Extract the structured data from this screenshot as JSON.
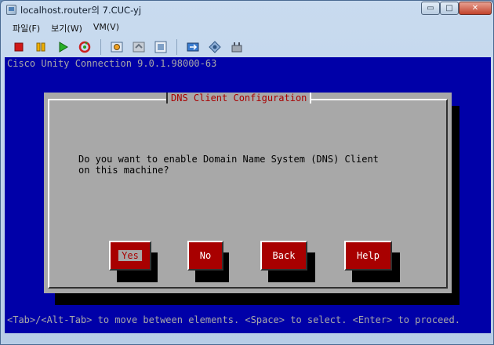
{
  "window": {
    "title": "localhost.router의 7.CUC-yj",
    "minimize_glyph": "▭",
    "maximize_glyph": "□",
    "close_glyph": "✕"
  },
  "menu": {
    "items": [
      "파일(F)",
      "보기(W)",
      "VM(V)"
    ]
  },
  "toolbar": {
    "icons": [
      "stop-icon",
      "pause-icon",
      "play-icon",
      "reset-icon",
      "snapshot-icon",
      "revert-snapshot-icon",
      "manage-snapshots-icon",
      "fullscreen-icon",
      "unity-icon",
      "console-settings-icon"
    ]
  },
  "console": {
    "header": "Cisco Unity Connection 9.0.1.98000-63",
    "dialog": {
      "title": "DNS Client Configuration",
      "message_line1": "Do you want to enable Domain Name System (DNS) Client",
      "message_line2": "on this machine?",
      "buttons": {
        "yes": "Yes",
        "no": "No",
        "back": "Back",
        "help": "Help"
      }
    },
    "footer": "<Tab>/<Alt-Tab> to move between elements. <Space> to select. <Enter> to proceed."
  },
  "colors": {
    "console_bg": "#0000a8",
    "dialog_bg": "#a8a8a8",
    "button_bg": "#a80000",
    "title_red": "#a80000"
  }
}
